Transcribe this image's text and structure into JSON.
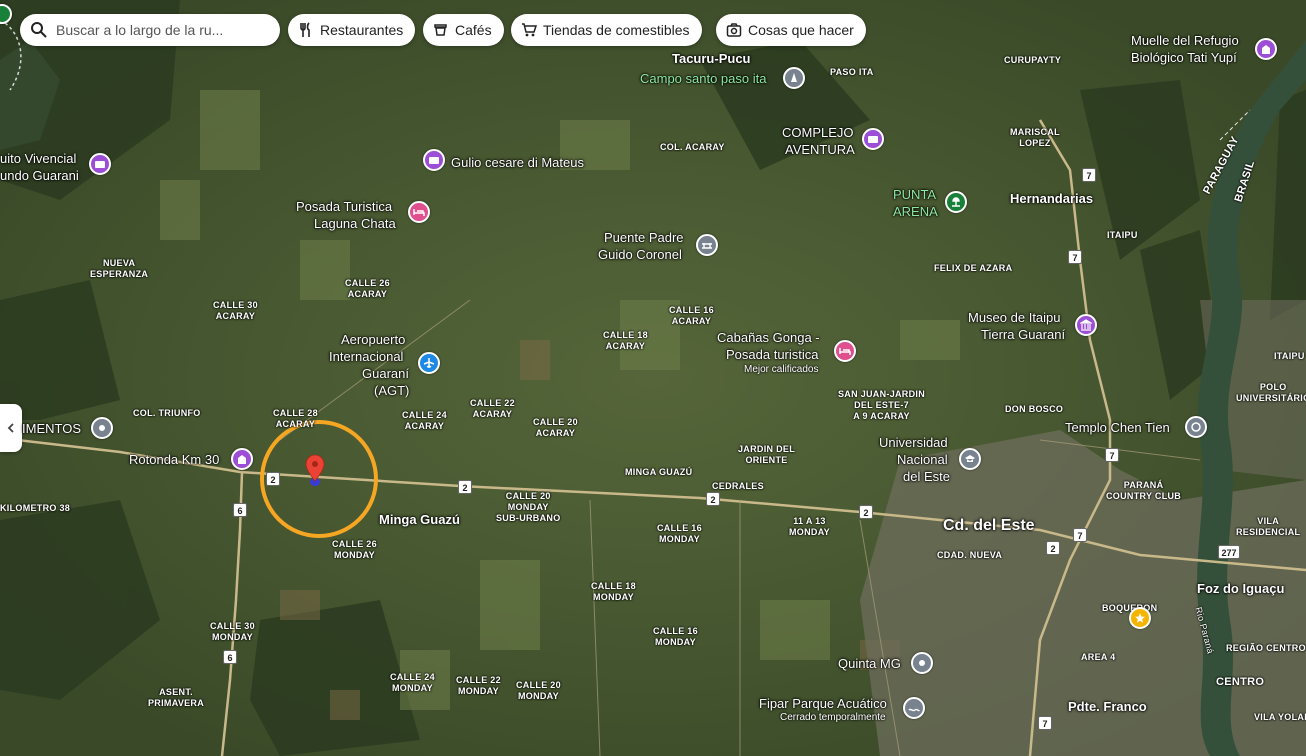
{
  "search": {
    "placeholder": "Buscar a lo largo de la ru..."
  },
  "chips": [
    {
      "label": "Restaurantes",
      "icon": "fork-knife-icon"
    },
    {
      "label": "Cafés",
      "icon": "coffee-cup-icon"
    },
    {
      "label": "Tiendas de comestibles",
      "icon": "shopping-cart-icon"
    },
    {
      "label": "Cosas que hacer",
      "icon": "camera-icon"
    }
  ],
  "places": {
    "tacuru": "Tacuru-Pucu",
    "campo_santo": "Campo santo paso ita",
    "paso_ita": "PASO ITA",
    "curupayty": "CURUPAYTY",
    "muelle_1": "Muelle del Refugio",
    "muelle_2": "Biológico Tati Yupí",
    "mariscal": "MARISCAL\nLOPEZ",
    "complejo_1": "COMPLEJO",
    "complejo_2": "AVENTURA",
    "col_acaray": "COL. ACARAY",
    "circuito_1": "uito Vivencial",
    "circuito_2": "undo Guarani",
    "gulio": "Gulio cesare di Mateus",
    "punta_1": "PUNTA",
    "punta_2": "ARENA",
    "hernandarias": "Hernandarias",
    "posada_1": "Posada Turistica",
    "posada_2": "Laguna Chata",
    "puente_1": "Puente Padre",
    "puente_2": "Guido Coronel",
    "itaipu": "ITAIPU",
    "paraguay": "PARAGUAY",
    "brasil": "BRASIL",
    "nueva_esperanza": "NUEVA\nESPERANZA",
    "felix": "FELIX DE AZARA",
    "calle26_acaray": "CALLE 26\nACARAY",
    "calle30_acaray": "CALLE 30\nACARAY",
    "calle16_acaray": "CALLE 16\nACARAY",
    "museo_1": "Museo de Itaipu",
    "museo_2": "Tierra Guaraní",
    "aeropuerto_1": "Aeropuerto",
    "aeropuerto_2": "Internacional",
    "aeropuerto_3": "Guaraní",
    "aeropuerto_4": "(AGT)",
    "calle18_acaray": "CALLE 18\nACARAY",
    "cabanas_1": "Cabañas Gonga -",
    "cabanas_2": "Posada turistica",
    "cabanas_3": "Mejor calificados",
    "itaipulandia": "ITAIPU",
    "polo": "POLO\nUNIVERSITÁRIO",
    "san_juan": "SAN JUAN-JARDIN\nDEL ESTE-7\nA 9 ACARAY",
    "don_bosco": "DON BOSCO",
    "col_triunfo": "COL. TRIUNFO",
    "calle28_acaray": "CALLE 28\nACARAY",
    "calle24_acaray": "CALLE 24\nACARAY",
    "calle22_acaray": "CALLE 22\nACARAY",
    "calle20_acaray": "CALLE 20\nACARAY",
    "templo": "Templo Chen Tien",
    "mentos": "IMENTOS",
    "universidad_1": "Universidad",
    "universidad_2": "Nacional",
    "universidad_3": "del Este",
    "rotonda": "Rotonda Km 30",
    "jardin_oriente": "JARDIN DEL\nORIENTE",
    "minga_guazu_small": "MINGA GUAZÚ",
    "parana": "PARANÁ\nCOUNTRY CLUB",
    "cedrales": "CEDRALES",
    "kilometro38": "KILOMETRO 38",
    "calle20_monday": "CALLE 20\nMONDAY\nSUB-URBANO",
    "minga_guazu": "Minga Guazú",
    "calle16_monday": "CALLE 16\nMONDAY",
    "monday_11_13": "11 A 13\nMONDAY",
    "vila_residencial": "VILA\nRESIDENCIAL",
    "cd_del_este": "Cd. del Este",
    "calle26_monday": "CALLE 26\nMONDAY",
    "cdad_nueva": "CDAD. NUEVA",
    "foz": "Foz do Iguaçu",
    "calle18_monday": "CALLE 18\nMONDAY",
    "boqueron": "BOQUERON",
    "calle30_monday": "CALLE 30\nMONDAY",
    "calle16_monday_b": "CALLE 16\nMONDAY",
    "regiao_centro": "REGIÃO CENTRO",
    "quinta": "Quinta MG",
    "area4": "AREA 4",
    "centro": "CENTRO",
    "calle24_monday": "CALLE 24\nMONDAY",
    "calle22_monday": "CALLE 22\nMONDAY",
    "calle20_monday_b": "CALLE 20\nMONDAY",
    "asent": "ASENT.\nPRIMAVERA",
    "fipar_1": "Fipar Parque Acuático",
    "fipar_2": "Cerrado temporalmente",
    "pdte_franco": "Pdte. Franco",
    "vila_yolanda": "VILA YOLAN",
    "rio_parana": "Rio Paraná"
  },
  "routes": {
    "r2": "2",
    "r6": "6",
    "r7": "7",
    "r277": "277"
  },
  "colors": {
    "pin_purple": "#9c4fd6",
    "pin_pink": "#e0508f",
    "pin_blue": "#1e88e5",
    "pin_gray": "#78838f",
    "pin_green": "#188038",
    "pin_yellow": "#f5b400",
    "marker_red": "#ea4335",
    "highlight_circle": "#f5a623"
  }
}
